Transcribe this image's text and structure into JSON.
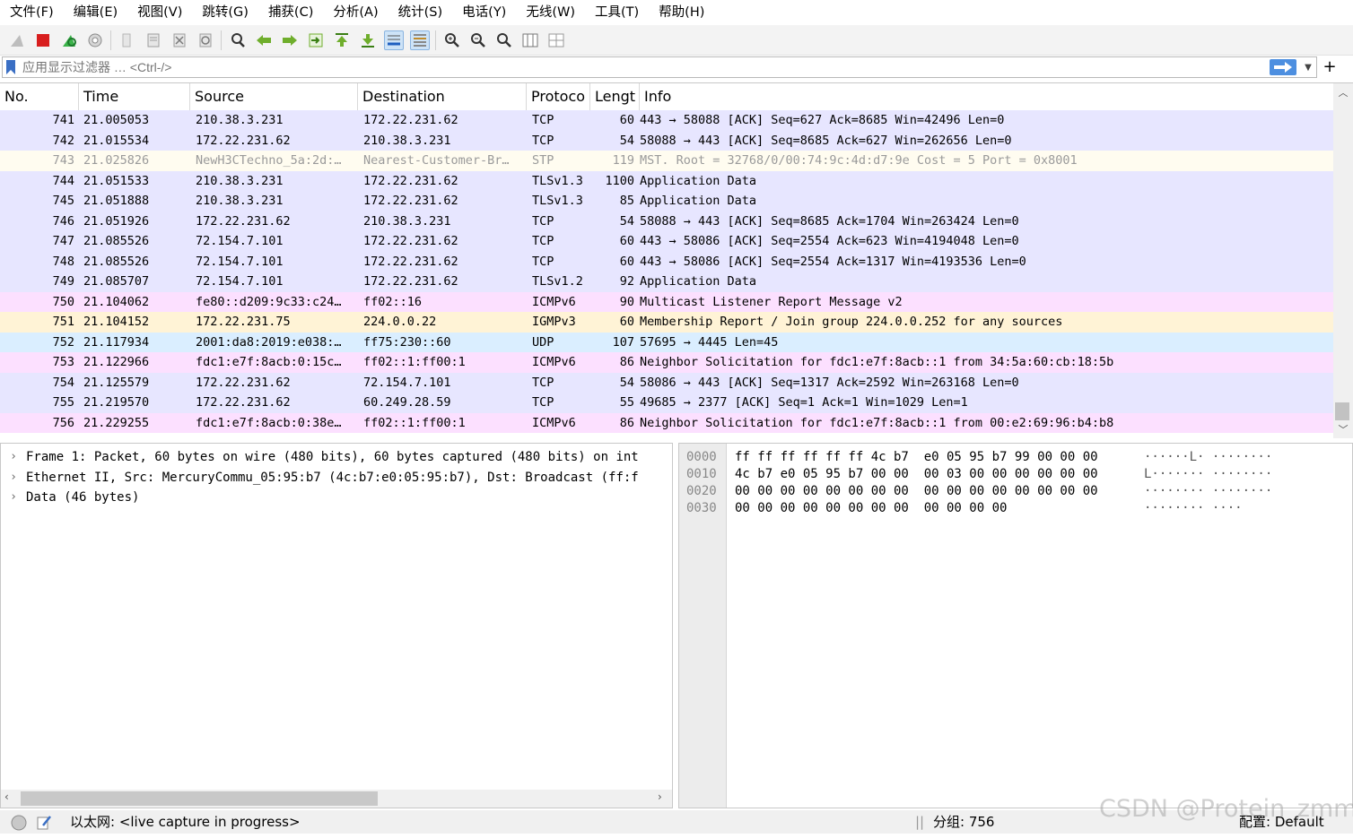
{
  "menu": [
    "文件(F)",
    "编辑(E)",
    "视图(V)",
    "跳转(G)",
    "捕获(C)",
    "分析(A)",
    "统计(S)",
    "电话(Y)",
    "无线(W)",
    "工具(T)",
    "帮助(H)"
  ],
  "toolbar": {
    "icons": [
      "shark-fin-icon",
      "stop-capture-icon",
      "restart-capture-icon",
      "capture-options-icon",
      "open-file-icon",
      "save-file-icon",
      "close-file-icon",
      "reload-file-icon",
      "find-packet-icon",
      "go-back-icon",
      "go-forward-icon",
      "go-to-packet-icon",
      "first-packet-icon",
      "last-packet-icon",
      "autoscroll-icon",
      "colorize-icon",
      "zoom-in-icon",
      "zoom-out-icon",
      "normal-size-icon",
      "resize-columns-icon",
      "expand-subtrees-icon"
    ]
  },
  "filter": {
    "placeholder": "应用显示过滤器 … <Ctrl-/>",
    "plus": "+"
  },
  "columns": [
    "No.",
    "Time",
    "Source",
    "Destination",
    "Protoco",
    "Lengt",
    "Info"
  ],
  "colors": {
    "tcp": "#e7e6ff",
    "stp": "#fffcf0",
    "icmpv6": "#fce0ff",
    "igmp": "#fff3d6",
    "udp": "#daeeff",
    "grey_text": "#9a9a9a",
    "status_bg": "#f0f0f0"
  },
  "packets": [
    {
      "no": "741",
      "time": "21.005053",
      "src": "210.38.3.231",
      "dst": "172.22.231.62",
      "proto": "TCP",
      "len": "60",
      "info": "443 → 58088 [ACK] Seq=627 Ack=8685 Win=42496 Len=0",
      "color": "tcp"
    },
    {
      "no": "742",
      "time": "21.015534",
      "src": "172.22.231.62",
      "dst": "210.38.3.231",
      "proto": "TCP",
      "len": "54",
      "info": "58088 → 443 [ACK] Seq=8685 Ack=627 Win=262656 Len=0",
      "color": "tcp"
    },
    {
      "no": "743",
      "time": "21.025826",
      "src": "NewH3CTechno_5a:2d:…",
      "dst": "Nearest-Customer-Br…",
      "proto": "STP",
      "len": "119",
      "info": "MST. Root = 32768/0/00:74:9c:4d:d7:9e  Cost = 5  Port = 0x8001",
      "color": "stp"
    },
    {
      "no": "744",
      "time": "21.051533",
      "src": "210.38.3.231",
      "dst": "172.22.231.62",
      "proto": "TLSv1.3",
      "len": "1100",
      "info": "Application Data",
      "color": "tcp"
    },
    {
      "no": "745",
      "time": "21.051888",
      "src": "210.38.3.231",
      "dst": "172.22.231.62",
      "proto": "TLSv1.3",
      "len": "85",
      "info": "Application Data",
      "color": "tcp"
    },
    {
      "no": "746",
      "time": "21.051926",
      "src": "172.22.231.62",
      "dst": "210.38.3.231",
      "proto": "TCP",
      "len": "54",
      "info": "58088 → 443 [ACK] Seq=8685 Ack=1704 Win=263424 Len=0",
      "color": "tcp"
    },
    {
      "no": "747",
      "time": "21.085526",
      "src": "72.154.7.101",
      "dst": "172.22.231.62",
      "proto": "TCP",
      "len": "60",
      "info": "443 → 58086 [ACK] Seq=2554 Ack=623 Win=4194048 Len=0",
      "color": "tcp"
    },
    {
      "no": "748",
      "time": "21.085526",
      "src": "72.154.7.101",
      "dst": "172.22.231.62",
      "proto": "TCP",
      "len": "60",
      "info": "443 → 58086 [ACK] Seq=2554 Ack=1317 Win=4193536 Len=0",
      "color": "tcp"
    },
    {
      "no": "749",
      "time": "21.085707",
      "src": "72.154.7.101",
      "dst": "172.22.231.62",
      "proto": "TLSv1.2",
      "len": "92",
      "info": "Application Data",
      "color": "tcp"
    },
    {
      "no": "750",
      "time": "21.104062",
      "src": "fe80::d209:9c33:c24…",
      "dst": "ff02::16",
      "proto": "ICMPv6",
      "len": "90",
      "info": "Multicast Listener Report Message v2",
      "color": "icmpv6"
    },
    {
      "no": "751",
      "time": "21.104152",
      "src": "172.22.231.75",
      "dst": "224.0.0.22",
      "proto": "IGMPv3",
      "len": "60",
      "info": "Membership Report / Join group 224.0.0.252 for any sources",
      "color": "igmp"
    },
    {
      "no": "752",
      "time": "21.117934",
      "src": "2001:da8:2019:e038:…",
      "dst": "ff75:230::60",
      "proto": "UDP",
      "len": "107",
      "info": "57695 → 4445 Len=45",
      "color": "udp"
    },
    {
      "no": "753",
      "time": "21.122966",
      "src": "fdc1:e7f:8acb:0:15c…",
      "dst": "ff02::1:ff00:1",
      "proto": "ICMPv6",
      "len": "86",
      "info": "Neighbor Solicitation for fdc1:e7f:8acb::1 from 34:5a:60:cb:18:5b",
      "color": "icmpv6"
    },
    {
      "no": "754",
      "time": "21.125579",
      "src": "172.22.231.62",
      "dst": "72.154.7.101",
      "proto": "TCP",
      "len": "54",
      "info": "58086 → 443 [ACK] Seq=1317 Ack=2592 Win=263168 Len=0",
      "color": "tcp"
    },
    {
      "no": "755",
      "time": "21.219570",
      "src": "172.22.231.62",
      "dst": "60.249.28.59",
      "proto": "TCP",
      "len": "55",
      "info": "49685 → 2377 [ACK] Seq=1 Ack=1 Win=1029 Len=1",
      "color": "tcp"
    },
    {
      "no": "756",
      "time": "21.229255",
      "src": "fdc1:e7f:8acb:0:38e…",
      "dst": "ff02::1:ff00:1",
      "proto": "ICMPv6",
      "len": "86",
      "info": "Neighbor Solicitation for fdc1:e7f:8acb::1 from 00:e2:69:96:b4:b8",
      "color": "icmpv6"
    }
  ],
  "details": [
    "Frame 1: Packet, 60 bytes on wire (480 bits), 60 bytes captured (480 bits) on int",
    "Ethernet II, Src: MercuryCommu_05:95:b7 (4c:b7:e0:05:95:b7), Dst: Broadcast (ff:f",
    "Data (46 bytes)"
  ],
  "bytes": [
    {
      "offset": "0000",
      "hex": "ff ff ff ff ff ff 4c b7  e0 05 95 b7 99 00 00 00",
      "ascii": "······L· ········"
    },
    {
      "offset": "0010",
      "hex": "4c b7 e0 05 95 b7 00 00  00 03 00 00 00 00 00 00",
      "ascii": "L······· ········"
    },
    {
      "offset": "0020",
      "hex": "00 00 00 00 00 00 00 00  00 00 00 00 00 00 00 00",
      "ascii": "········ ········"
    },
    {
      "offset": "0030",
      "hex": "00 00 00 00 00 00 00 00  00 00 00 00",
      "ascii": "········ ····"
    }
  ],
  "status": {
    "interface": "以太网: <live capture in progress>",
    "packets": "分组: 756",
    "profile": "配置: Default",
    "watermark": "CSDN @Protein_zmm"
  }
}
